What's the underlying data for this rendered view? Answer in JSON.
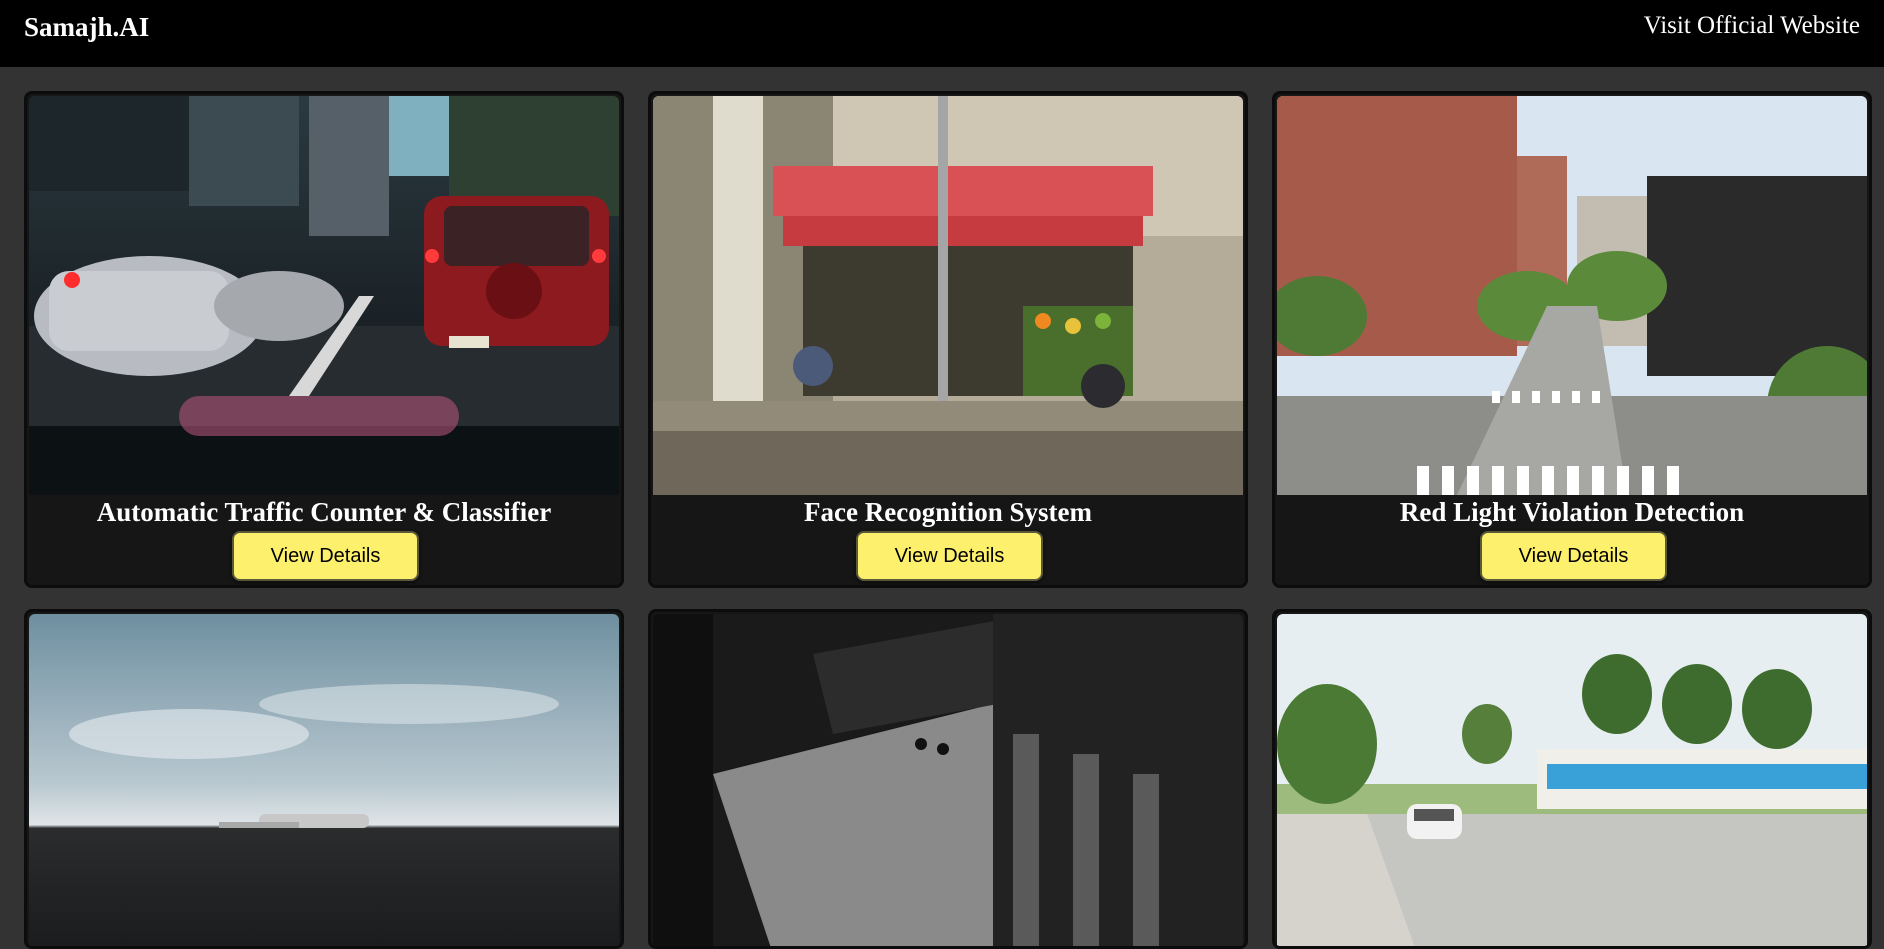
{
  "navbar": {
    "brand": "Samajh.AI",
    "link": "Visit Official Website"
  },
  "cards": [
    {
      "title": "Automatic Traffic Counter & Classifier",
      "button": "View Details",
      "image": "city-traffic-through-windshield"
    },
    {
      "title": "Face Recognition System",
      "button": "View Details",
      "image": "street-market-storefront"
    },
    {
      "title": "Red Light Violation Detection",
      "button": "View Details",
      "image": "city-crosswalk-intersection"
    },
    {
      "title": "",
      "button": "",
      "image": "plane-wreck-landscape"
    },
    {
      "title": "",
      "button": "",
      "image": "monochrome-courtyard"
    },
    {
      "title": "",
      "button": "",
      "image": "suburban-road-with-car"
    }
  ],
  "colors": {
    "page_background": "#333333",
    "navbar_background": "#000000",
    "card_background": "#161616",
    "button_background": "#fdf06c"
  }
}
